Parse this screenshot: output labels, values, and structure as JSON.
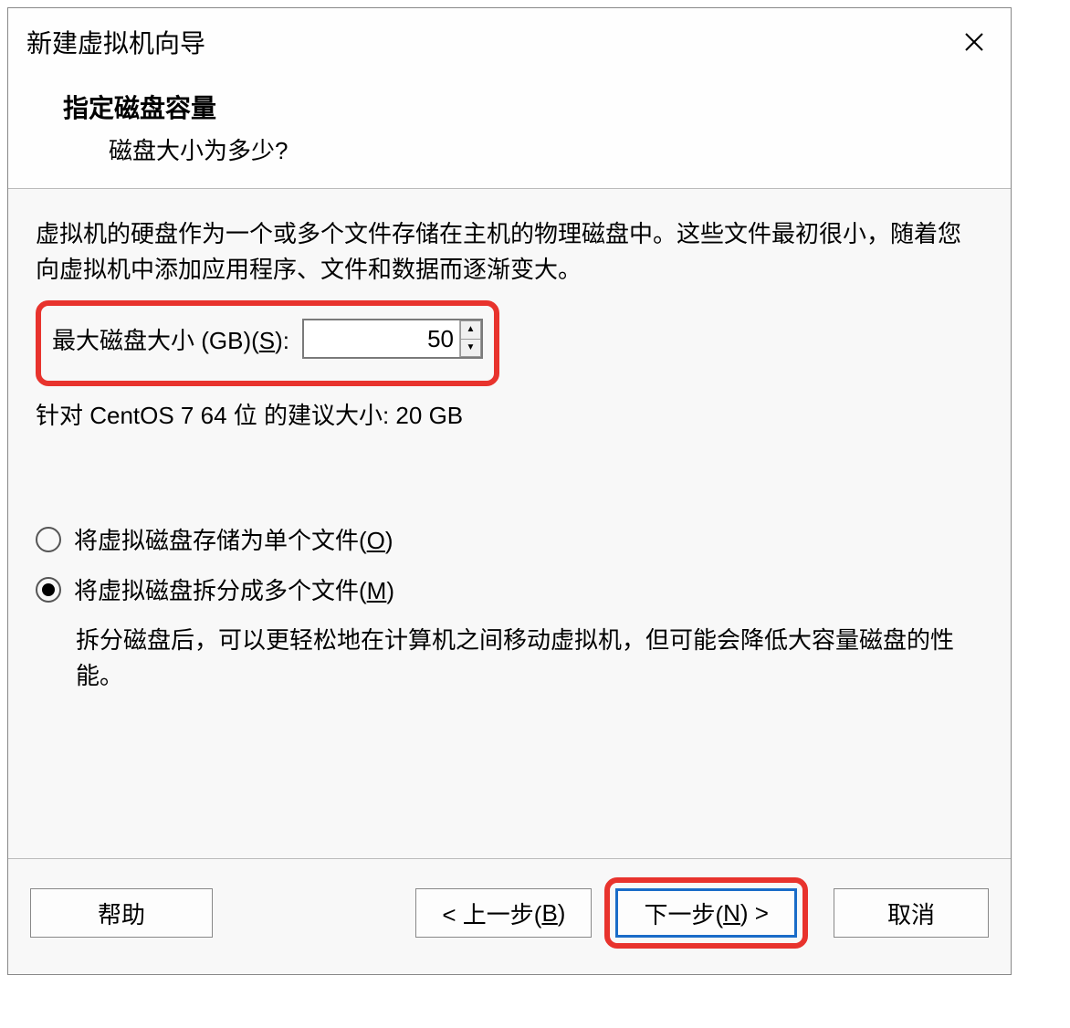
{
  "titlebar": {
    "title": "新建虚拟机向导"
  },
  "header": {
    "title": "指定磁盘容量",
    "subtitle": "磁盘大小为多少?"
  },
  "content": {
    "description": "虚拟机的硬盘作为一个或多个文件存储在主机的物理磁盘中。这些文件最初很小，随着您向虚拟机中添加应用程序、文件和数据而逐渐变大。",
    "disk_size_label_prefix": "最大磁盘大小 (GB)(",
    "disk_size_label_hotkey": "S",
    "disk_size_label_suffix": "):",
    "disk_size_value": "50",
    "suggested_size": "针对 CentOS 7 64 位 的建议大小: 20 GB",
    "radio_single_prefix": "将虚拟磁盘存储为单个文件(",
    "radio_single_hotkey": "O",
    "radio_single_suffix": ")",
    "radio_split_prefix": "将虚拟磁盘拆分成多个文件(",
    "radio_split_hotkey": "M",
    "radio_split_suffix": ")",
    "radio_split_hint": "拆分磁盘后，可以更轻松地在计算机之间移动虚拟机，但可能会降低大容量磁盘的性能。"
  },
  "footer": {
    "help": "帮助",
    "back_prefix": "< 上一步(",
    "back_hotkey": "B",
    "back_suffix": ")",
    "next_prefix": "下一步(",
    "next_hotkey": "N",
    "next_suffix": ") >",
    "cancel": "取消"
  }
}
